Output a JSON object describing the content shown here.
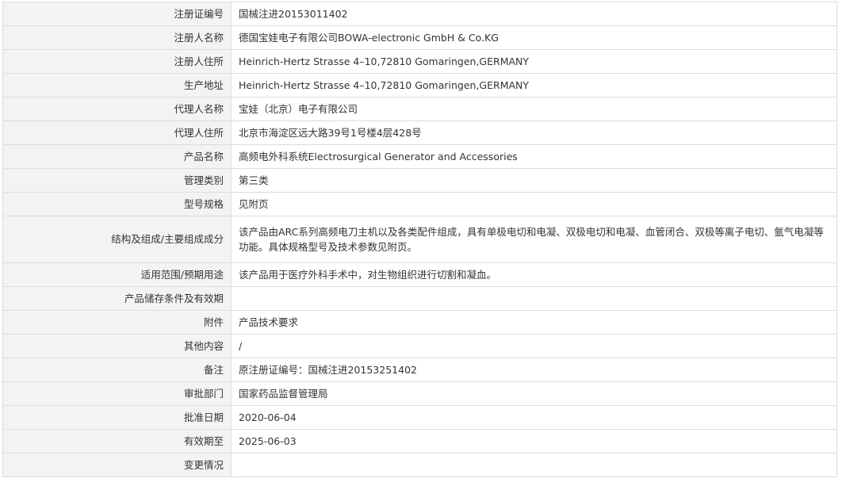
{
  "rows": [
    {
      "label": "注册证编号",
      "value": "国械注进20153011402"
    },
    {
      "label": "注册人名称",
      "value": "德国宝娃电子有限公司BOWA-electronic GmbH & Co.KG"
    },
    {
      "label": "注册人住所",
      "value": "Heinrich-Hertz Strasse 4–10,72810 Gomaringen,GERMANY"
    },
    {
      "label": "生产地址",
      "value": "Heinrich-Hertz Strasse 4–10,72810 Gomaringen,GERMANY"
    },
    {
      "label": "代理人名称",
      "value": "宝娃（北京）电子有限公司"
    },
    {
      "label": "代理人住所",
      "value": "北京市海淀区远大路39号1号楼4层428号"
    },
    {
      "label": "产品名称",
      "value": "高频电外科系统Electrosurgical Generator and Accessories"
    },
    {
      "label": "管理类别",
      "value": "第三类"
    },
    {
      "label": "型号规格",
      "value": "见附页"
    },
    {
      "label": "结构及组成/主要组成成分",
      "value": "该产品由ARC系列高频电刀主机以及各类配件组成，具有单极电切和电凝、双极电切和电凝、血管闭合、双极等离子电切、氩气电凝等功能。具体规格型号及技术参数见附页。"
    },
    {
      "label": "适用范围/预期用途",
      "value": "该产品用于医疗外科手术中，对生物组织进行切割和凝血。"
    },
    {
      "label": "产品储存条件及有效期",
      "value": ""
    },
    {
      "label": "附件",
      "value": "产品技术要求"
    },
    {
      "label": "其他内容",
      "value": "/"
    },
    {
      "label": "备注",
      "value": "原注册证编号：国械注进20153251402"
    },
    {
      "label": "审批部门",
      "value": "国家药品监督管理局"
    },
    {
      "label": "批准日期",
      "value": "2020-06-04"
    },
    {
      "label": "有效期至",
      "value": "2025-06-03"
    },
    {
      "label": "变更情况",
      "value": ""
    }
  ]
}
